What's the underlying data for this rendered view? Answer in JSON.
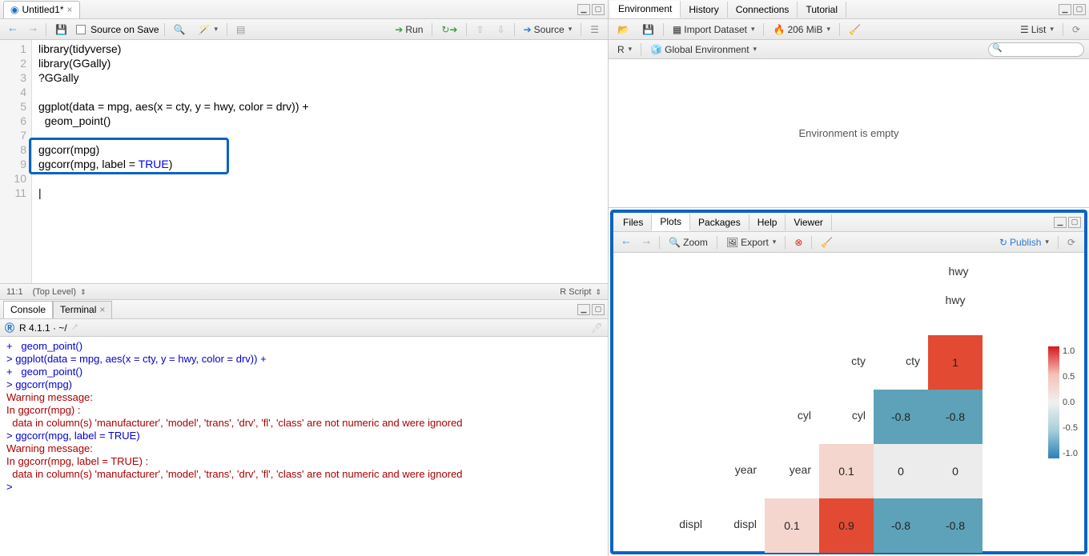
{
  "source": {
    "tab_title": "Untitled1*",
    "toolbar": {
      "source_on_save": "Source on Save",
      "run": "Run",
      "source_btn": "Source"
    },
    "lines": [
      "library(tidyverse)",
      "library(GGally)",
      "?GGally",
      "",
      "ggplot(data = mpg, aes(x = cty, y = hwy, color = drv)) +",
      "  geom_point()",
      "",
      "ggcorr(mpg)",
      "ggcorr(mpg, label = TRUE)",
      "",
      ""
    ],
    "highlighted_lines": [
      8,
      9
    ],
    "status": {
      "pos": "11:1",
      "scope": "(Top Level)",
      "lang": "R Script"
    }
  },
  "console": {
    "tab_console": "Console",
    "tab_terminal": "Terminal",
    "version": "R 4.1.1 · ~/",
    "lines": [
      {
        "cls": "cont",
        "text": "+   geom_point()"
      },
      {
        "cls": "cmd",
        "text": "> ggplot(data = mpg, aes(x = cty, y = hwy, color = drv)) +"
      },
      {
        "cls": "cont",
        "text": "+   geom_point()"
      },
      {
        "cls": "cmd",
        "text": "> ggcorr(mpg)"
      },
      {
        "cls": "err",
        "text": "Warning message:"
      },
      {
        "cls": "err",
        "text": "In ggcorr(mpg) :"
      },
      {
        "cls": "err",
        "text": "  data in column(s) 'manufacturer', 'model', 'trans', 'drv', 'fl', 'class' are not numeric and were ignored"
      },
      {
        "cls": "cmd",
        "text": "> ggcorr(mpg, label = TRUE)"
      },
      {
        "cls": "err",
        "text": "Warning message:"
      },
      {
        "cls": "err",
        "text": "In ggcorr(mpg, label = TRUE) :"
      },
      {
        "cls": "err",
        "text": "  data in column(s) 'manufacturer', 'model', 'trans', 'drv', 'fl', 'class' are not numeric and were ignored"
      },
      {
        "cls": "cmd",
        "text": "> "
      }
    ]
  },
  "environment": {
    "tabs": [
      "Environment",
      "History",
      "Connections",
      "Tutorial"
    ],
    "active_tab": 0,
    "import": "Import Dataset",
    "mem": "206 MiB",
    "list": "List",
    "scope_label": "R",
    "env_label": "Global Environment",
    "empty_msg": "Environment is empty"
  },
  "plots": {
    "tabs": [
      "Files",
      "Plots",
      "Packages",
      "Help",
      "Viewer"
    ],
    "active_tab": 1,
    "zoom": "Zoom",
    "export": "Export",
    "publish": "Publish"
  },
  "chart_data": {
    "type": "heatmap",
    "title": "",
    "variables": [
      "displ",
      "year",
      "cyl",
      "cty",
      "hwy"
    ],
    "matrix": {
      "displ": {
        "year": 0.1,
        "cyl": 0.9,
        "cty": -0.8,
        "hwy": -0.8
      },
      "year": {
        "cyl": 0.1,
        "cty": 0,
        "hwy": 0
      },
      "cyl": {
        "cty": -0.8,
        "hwy": -0.8
      },
      "cty": {
        "hwy": 1
      }
    },
    "colorscale": {
      "min": -1.0,
      "mid": 0.0,
      "max": 1.0,
      "low_color": "#2c7fb8",
      "mid_color": "#f0f0f0",
      "high_color": "#d7191c"
    },
    "legend_ticks": [
      1.0,
      0.5,
      0.0,
      -0.5,
      -1.0
    ]
  }
}
